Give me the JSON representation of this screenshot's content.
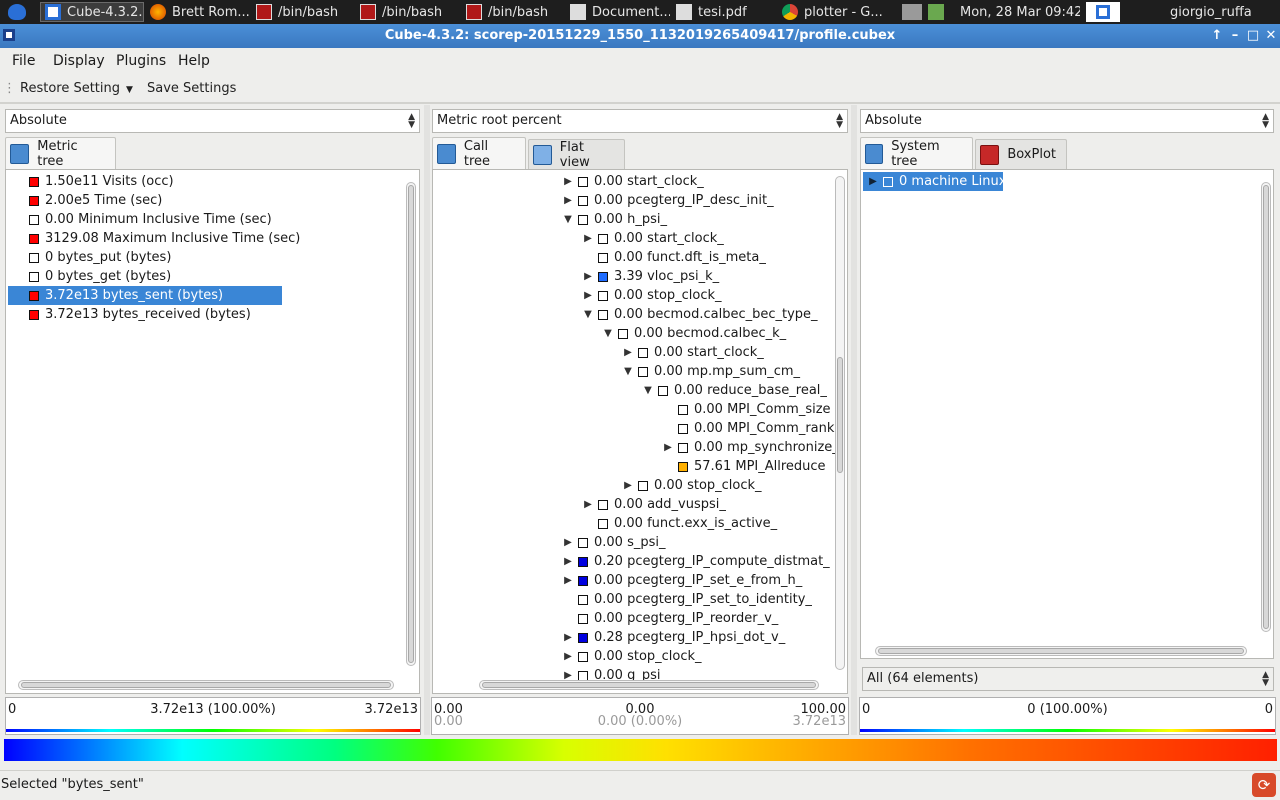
{
  "taskbar": {
    "items": [
      {
        "label": "Cube-4.3.2...",
        "icon": "cube-app-icon"
      },
      {
        "label": "Brett Rom...",
        "icon": "firefox-icon"
      },
      {
        "label": "/bin/bash",
        "icon": "terminal-icon"
      },
      {
        "label": "/bin/bash",
        "icon": "terminal-icon"
      },
      {
        "label": "/bin/bash",
        "icon": "terminal-icon"
      },
      {
        "label": "Document...",
        "icon": "tex-icon"
      },
      {
        "label": "tesi.pdf",
        "icon": "tex-icon"
      },
      {
        "label": "plotter - G...",
        "icon": "chrome-icon"
      }
    ],
    "clock": "Mon, 28 Mar  09:42",
    "user": "giorgio_ruffa"
  },
  "window": {
    "title": "Cube-4.3.2: scorep-20151229_1550_1132019265409417/profile.cubex"
  },
  "menubar": {
    "items": [
      "File",
      "Display",
      "Plugins",
      "Help"
    ]
  },
  "toolbar": {
    "restore_label": "Restore Setting",
    "save_label": "Save Settings"
  },
  "metric_panel": {
    "combo_value": "Absolute",
    "tab_label": "Metric tree",
    "rows": [
      {
        "text": "1.50e11 Visits (occ)",
        "color": "#ff0000"
      },
      {
        "text": "2.00e5 Time (sec)",
        "color": "#ff0000"
      },
      {
        "text": "0.00 Minimum Inclusive Time (sec)",
        "color": "#ffffff"
      },
      {
        "text": "3129.08 Maximum Inclusive Time (sec)",
        "color": "#ff0000"
      },
      {
        "text": "0 bytes_put (bytes)",
        "color": "#ffffff"
      },
      {
        "text": "0 bytes_get (bytes)",
        "color": "#ffffff"
      },
      {
        "text": "3.72e13 bytes_sent (bytes)",
        "color": "#ff0000",
        "selected": true
      },
      {
        "text": "3.72e13 bytes_received (bytes)",
        "color": "#ff0000"
      }
    ],
    "valbar": {
      "min": "0",
      "center": "3.72e13 (100.00%)",
      "max": "3.72e13"
    }
  },
  "call_panel": {
    "combo_value": "Metric root percent",
    "tabs": [
      "Call tree",
      "Flat view"
    ],
    "rows": [
      {
        "text": "0.00 start_clock_",
        "indent": 0,
        "exp": "▶",
        "color": "#ffffff"
      },
      {
        "text": "0.00 pcegterg_IP_desc_init_",
        "indent": 0,
        "exp": "▶",
        "color": "#ffffff"
      },
      {
        "text": "0.00 h_psi_",
        "indent": 0,
        "exp": "▼",
        "color": "#ffffff"
      },
      {
        "text": "0.00 start_clock_",
        "indent": 1,
        "exp": "▶",
        "color": "#ffffff"
      },
      {
        "text": "0.00 funct.dft_is_meta_",
        "indent": 1,
        "exp": "",
        "color": "#ffffff"
      },
      {
        "text": "3.39 vloc_psi_k_",
        "indent": 1,
        "exp": "▶",
        "color": "#1e6cff"
      },
      {
        "text": "0.00 stop_clock_",
        "indent": 1,
        "exp": "▶",
        "color": "#ffffff"
      },
      {
        "text": "0.00 becmod.calbec_bec_type_",
        "indent": 1,
        "exp": "▼",
        "color": "#ffffff"
      },
      {
        "text": "0.00 becmod.calbec_k_",
        "indent": 2,
        "exp": "▼",
        "color": "#ffffff"
      },
      {
        "text": "0.00 start_clock_",
        "indent": 3,
        "exp": "▶",
        "color": "#ffffff"
      },
      {
        "text": "0.00 mp.mp_sum_cm_",
        "indent": 3,
        "exp": "▼",
        "color": "#ffffff"
      },
      {
        "text": "0.00 reduce_base_real_",
        "indent": 4,
        "exp": "▼",
        "color": "#ffffff"
      },
      {
        "text": "0.00 MPI_Comm_size",
        "indent": 5,
        "exp": "",
        "color": "#ffffff"
      },
      {
        "text": "0.00 MPI_Comm_rank",
        "indent": 5,
        "exp": "",
        "color": "#ffffff"
      },
      {
        "text": "0.00 mp_synchronize_",
        "indent": 5,
        "exp": "▶",
        "color": "#ffffff"
      },
      {
        "text": "57.61 MPI_Allreduce",
        "indent": 5,
        "exp": "",
        "color": "#ffb000"
      },
      {
        "text": "0.00 stop_clock_",
        "indent": 3,
        "exp": "▶",
        "color": "#ffffff"
      },
      {
        "text": "0.00 add_vuspsi_",
        "indent": 1,
        "exp": "▶",
        "color": "#ffffff"
      },
      {
        "text": "0.00 funct.exx_is_active_",
        "indent": 1,
        "exp": "",
        "color": "#ffffff"
      },
      {
        "text": "0.00 s_psi_",
        "indent": 0,
        "exp": "▶",
        "color": "#ffffff"
      },
      {
        "text": "0.20 pcegterg_IP_compute_distmat_",
        "indent": 0,
        "exp": "▶",
        "color": "#0000e0"
      },
      {
        "text": "0.00 pcegterg_IP_set_e_from_h_",
        "indent": 0,
        "exp": "▶",
        "color": "#0000e0"
      },
      {
        "text": "0.00 pcegterg_IP_set_to_identity_",
        "indent": 0,
        "exp": "",
        "color": "#ffffff"
      },
      {
        "text": "0.00 pcegterg_IP_reorder_v_",
        "indent": 0,
        "exp": "",
        "color": "#ffffff"
      },
      {
        "text": "0.28 pcegterg_IP_hpsi_dot_v_",
        "indent": 0,
        "exp": "▶",
        "color": "#0000e0"
      },
      {
        "text": "0.00 stop_clock_",
        "indent": 0,
        "exp": "▶",
        "color": "#ffffff"
      },
      {
        "text": "0.00 g_psi_",
        "indent": 0,
        "exp": "▶",
        "color": "#ffffff"
      }
    ],
    "valbar": {
      "min": "0.00",
      "center": "0.00",
      "max": "100.00",
      "min2": "0.00",
      "center2": "0.00 (0.00%)",
      "max2": "3.72e13"
    }
  },
  "system_panel": {
    "combo_value": "Absolute",
    "tabs": [
      "System tree",
      "BoxPlot"
    ],
    "rows": [
      {
        "text": "0 machine Linux",
        "selected": true
      }
    ],
    "filter_value": "All (64 elements)",
    "valbar": {
      "min": "0",
      "center": "0 (100.00%)",
      "max": "0"
    }
  },
  "status": {
    "text": "Selected \"bytes_sent\""
  },
  "colors": {
    "selection": "#3a86d6",
    "titlebar": "#3f80c8"
  }
}
